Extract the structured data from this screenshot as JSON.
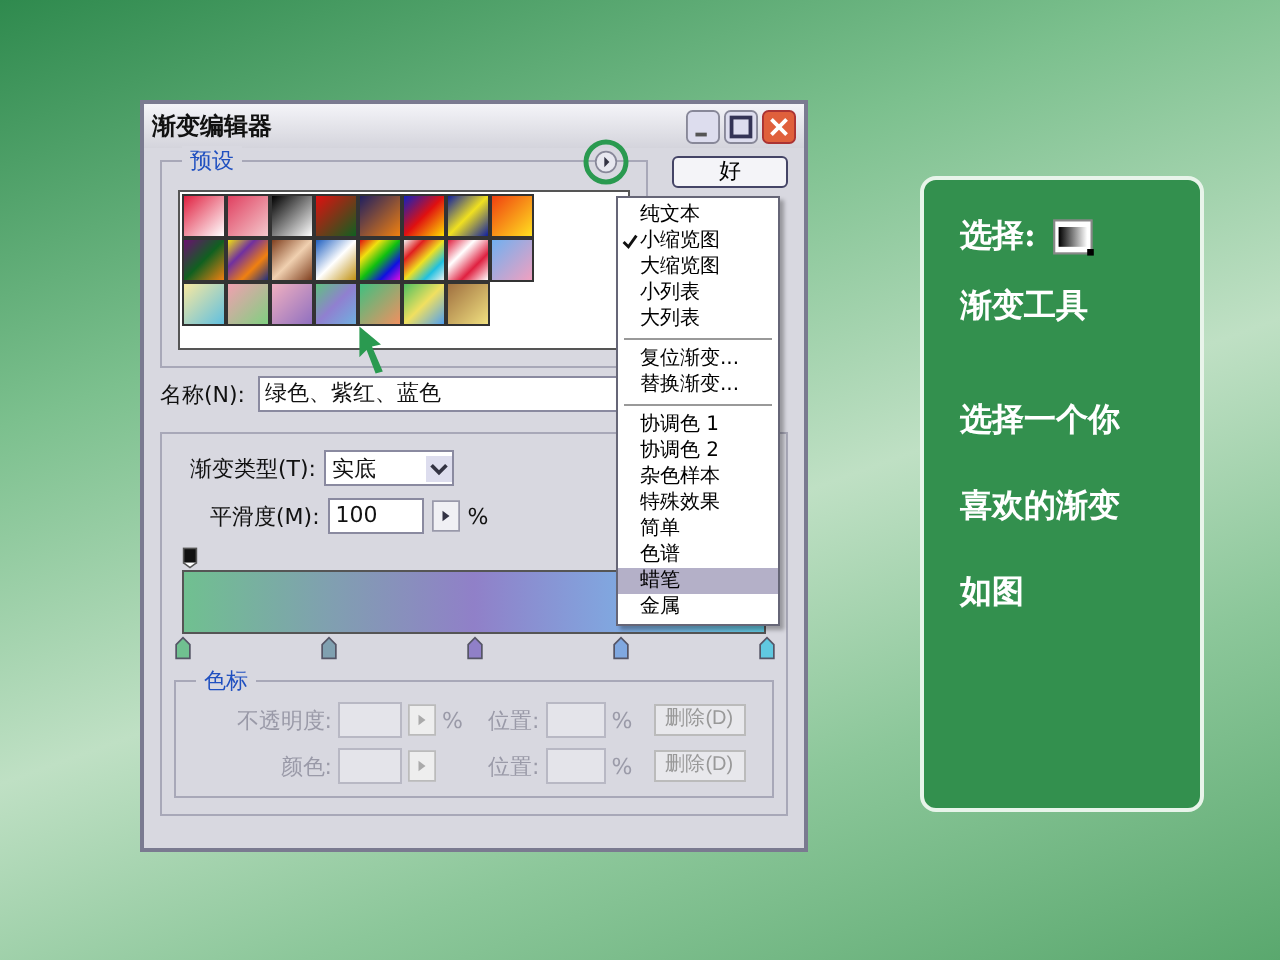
{
  "dialog": {
    "title": "渐变编辑器",
    "presets": {
      "legend": "预设"
    },
    "ok_button": "好",
    "name_label": "名称(N):",
    "name_value": "绿色、紫红、蓝色",
    "type_label": "渐变类型(T):",
    "type_value": "实底",
    "smooth_label": "平滑度(M):",
    "smooth_value": "100",
    "smooth_unit": "%",
    "color_stops": [
      {
        "color": "#70c090"
      },
      {
        "color": "#80a0b0"
      },
      {
        "color": "#9080c8"
      },
      {
        "color": "#80a8e0"
      },
      {
        "color": "#60c8e0"
      }
    ],
    "stops_group": {
      "legend": "色标",
      "disabled": true,
      "rows": [
        {
          "label": "不透明度:",
          "unit": "%",
          "position_label": "位置:",
          "position_unit": "%",
          "delete_button": "删除(D)"
        },
        {
          "label": "颜色:",
          "unit": "",
          "position_label": "位置:",
          "position_unit": "%",
          "delete_button": "删除(D)"
        }
      ]
    }
  },
  "menu": {
    "groups": [
      [
        {
          "label": "纯文本",
          "checked": false,
          "selected": false
        },
        {
          "label": "小缩览图",
          "checked": true,
          "selected": false
        },
        {
          "label": "大缩览图",
          "checked": false,
          "selected": false
        },
        {
          "label": "小列表",
          "checked": false,
          "selected": false
        },
        {
          "label": "大列表",
          "checked": false,
          "selected": false
        }
      ],
      [
        {
          "label": "复位渐变...",
          "checked": false,
          "selected": false
        },
        {
          "label": "替换渐变...",
          "checked": false,
          "selected": false
        }
      ],
      [
        {
          "label": "协调色 1",
          "checked": false,
          "selected": false
        },
        {
          "label": "协调色 2",
          "checked": false,
          "selected": false
        },
        {
          "label": "杂色样本",
          "checked": false,
          "selected": false
        },
        {
          "label": "特殊效果",
          "checked": false,
          "selected": false
        },
        {
          "label": "简单",
          "checked": false,
          "selected": false
        },
        {
          "label": "色谱",
          "checked": false,
          "selected": false
        },
        {
          "label": "蜡笔",
          "checked": false,
          "selected": true
        },
        {
          "label": "金属",
          "checked": false,
          "selected": false
        }
      ]
    ]
  },
  "note": {
    "line1": "选择:",
    "line2": "渐变工具",
    "body": [
      "选择一个你",
      "喜欢的渐变",
      "如图"
    ]
  }
}
